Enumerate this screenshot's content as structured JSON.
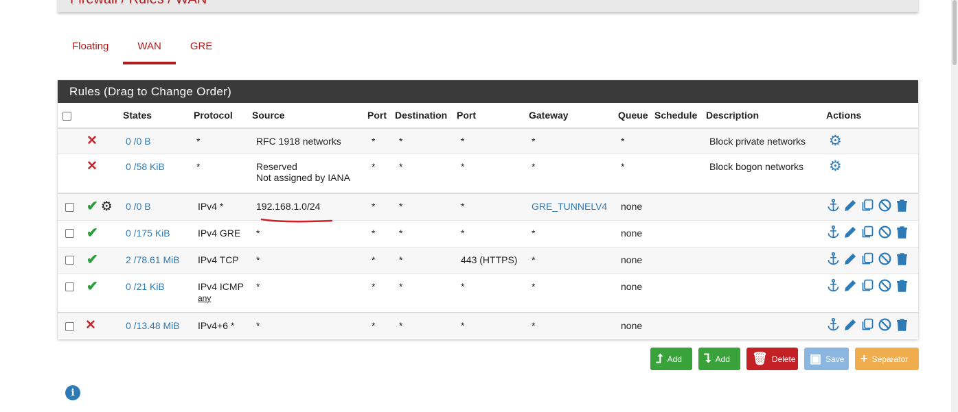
{
  "breadcrumb": [
    "Firewall",
    "Rules",
    "WAN"
  ],
  "tabs": [
    {
      "label": "Floating",
      "active": false
    },
    {
      "label": "WAN",
      "active": true
    },
    {
      "label": "GRE",
      "active": false
    }
  ],
  "panel": {
    "title": "Rules (Drag to Change Order)"
  },
  "columns": [
    "States",
    "Protocol",
    "Source",
    "Port",
    "Destination",
    "Port",
    "Gateway",
    "Queue",
    "Schedule",
    "Description",
    "Actions"
  ],
  "rules": [
    {
      "status": "block",
      "states": "0 /0 B",
      "protocol": "*",
      "source": "RFC 1918 networks",
      "source2": "",
      "sport": "*",
      "dest": "*",
      "dport": "*",
      "gateway": "*",
      "queue": "*",
      "schedule": "",
      "description": "Block private networks"
    },
    {
      "status": "block",
      "states": "0 /58 KiB",
      "protocol": "*",
      "source": "Reserved",
      "source2": "Not assigned by IANA",
      "sport": "*",
      "dest": "*",
      "dport": "*",
      "gateway": "*",
      "queue": "*",
      "schedule": "",
      "description": "Block bogon networks"
    },
    {
      "status": "pass",
      "states": "0 /0 B",
      "protocol": "IPv4 *",
      "protocol_sub": "",
      "source": "192.168.1.0/24",
      "sport": "*",
      "dest": "*",
      "dport": "*",
      "gateway": "GRE_TUNNELV4",
      "queue": "none",
      "schedule": "",
      "description": ""
    },
    {
      "status": "pass",
      "states": "0 /175 KiB",
      "protocol": "IPv4 GRE",
      "protocol_sub": "",
      "source": "*",
      "sport": "*",
      "dest": "*",
      "dport": "*",
      "gateway": "*",
      "queue": "none",
      "schedule": "",
      "description": ""
    },
    {
      "status": "pass",
      "states": "2 /78.61 MiB",
      "protocol": "IPv4 TCP",
      "protocol_sub": "",
      "source": "*",
      "sport": "*",
      "dest": "*",
      "dport": "443 (HTTPS)",
      "gateway": "*",
      "queue": "none",
      "schedule": "",
      "description": ""
    },
    {
      "status": "pass",
      "states": "0 /21 KiB",
      "protocol": "IPv4 ICMP",
      "protocol_sub": "any",
      "source": "*",
      "sport": "*",
      "dest": "*",
      "dport": "*",
      "gateway": "*",
      "queue": "none",
      "schedule": "",
      "description": ""
    },
    {
      "status": "block",
      "states": "0 /13.48 MiB",
      "protocol": "IPv4+6 *",
      "protocol_sub": "",
      "source": "*",
      "sport": "*",
      "dest": "*",
      "dport": "*",
      "gateway": "*",
      "queue": "none",
      "schedule": "",
      "description": ""
    }
  ],
  "buttons": {
    "add_top": "Add",
    "add_bottom": "Add",
    "delete": "Delete",
    "save": "Save",
    "separator": "Separator"
  },
  "colors": {
    "accent_red": "#b01c1c",
    "link_blue": "#2d7bb6",
    "pass_green": "#2a9d3a",
    "block_red": "#c0272d",
    "header_dark": "#3a3a3a"
  }
}
